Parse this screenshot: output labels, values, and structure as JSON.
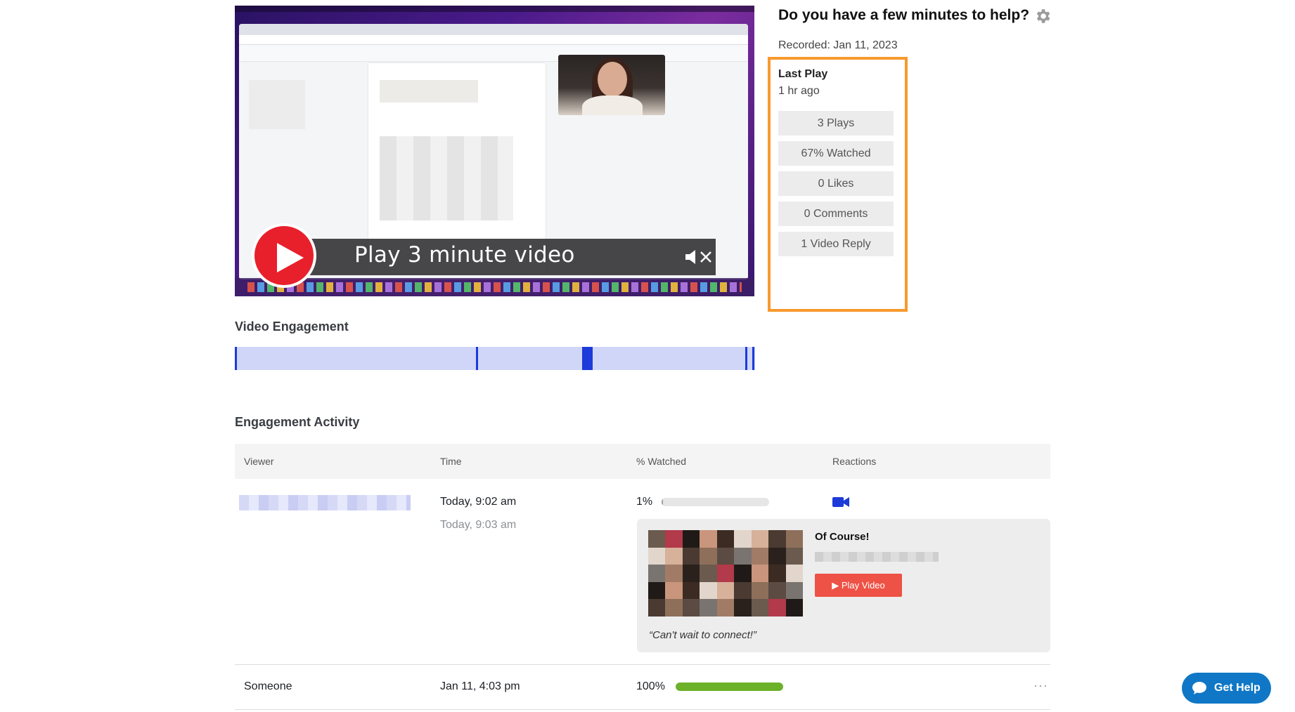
{
  "video": {
    "play_label": "Play 3 minute video"
  },
  "header": {
    "title": "Do you have a few minutes to help?",
    "recorded": "Recorded: Jan 11, 2023"
  },
  "stats": {
    "last_play_label": "Last Play",
    "last_play_value": "1 hr ago",
    "items": [
      "3 Plays",
      "67% Watched",
      "0 Likes",
      "0 Comments",
      "1 Video Reply"
    ],
    "highlight_color": "#f79a2e"
  },
  "engagement": {
    "title": "Video Engagement",
    "bar_color": "#d0d6f8",
    "marker_color": "#1c3bd9"
  },
  "activity": {
    "title": "Engagement Activity",
    "columns": [
      "Viewer",
      "Time",
      "% Watched",
      "Reactions"
    ],
    "rows": [
      {
        "viewer": "",
        "time": "Today, 9:02 am",
        "time2": "Today, 9:03 am",
        "watched": "1%",
        "watched_fraction": 0.01,
        "reply": {
          "title": "Of Course!",
          "button": "▶ Play Video",
          "quote": "“Can't wait to connect!”"
        }
      },
      {
        "viewer": "Someone",
        "time": "Jan 11, 4:03 pm",
        "watched": "100%",
        "watched_fraction": 1.0
      }
    ],
    "more_label": "···"
  },
  "help": {
    "label": "Get Help",
    "color": "#0f77c6"
  }
}
